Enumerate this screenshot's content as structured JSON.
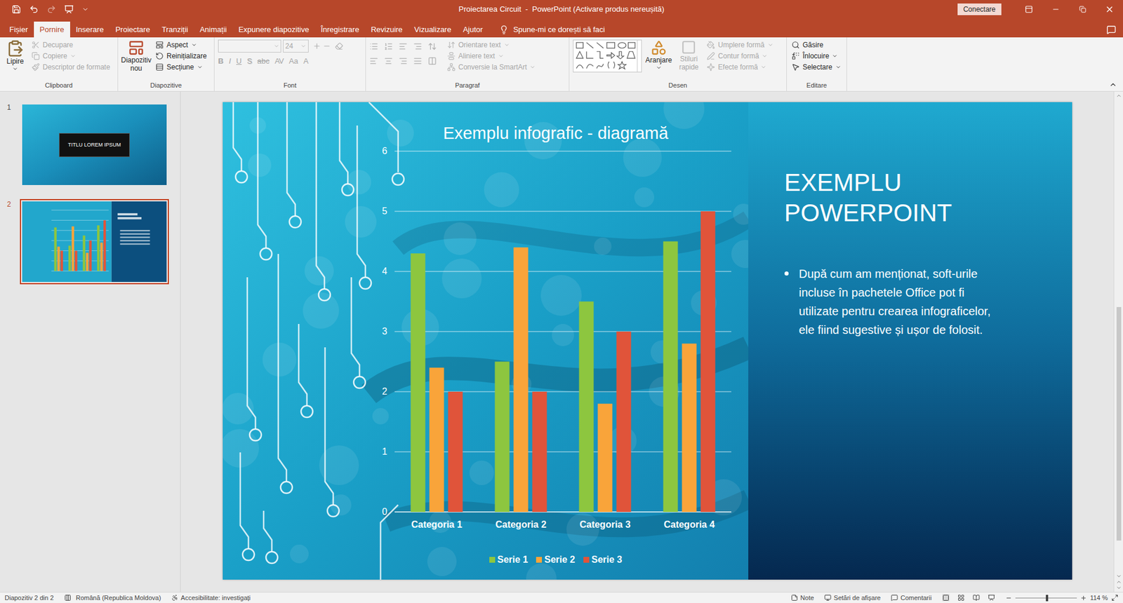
{
  "window": {
    "title": "Proiectarea Circuit  -  PowerPoint (Activare produs nereușită)",
    "sign_in": "Conectare"
  },
  "tabs": [
    {
      "label": "Fișier",
      "selected": false
    },
    {
      "label": "Pornire",
      "selected": true
    },
    {
      "label": "Inserare",
      "selected": false
    },
    {
      "label": "Proiectare",
      "selected": false
    },
    {
      "label": "Tranziții",
      "selected": false
    },
    {
      "label": "Animații",
      "selected": false
    },
    {
      "label": "Expunere diapozitive",
      "selected": false
    },
    {
      "label": "Înregistrare",
      "selected": false
    },
    {
      "label": "Revizuire",
      "selected": false
    },
    {
      "label": "Vizualizare",
      "selected": false
    },
    {
      "label": "Ajutor",
      "selected": false
    }
  ],
  "tell_me": "Spune-mi ce dorești să faci",
  "ribbon": {
    "clipboard": {
      "label": "Clipboard",
      "paste": "Lipire",
      "items": [
        {
          "label": "Decupare",
          "disabled": true
        },
        {
          "label": "Copiere",
          "disabled": true
        },
        {
          "label": "Descriptor de formate",
          "disabled": true
        }
      ]
    },
    "slides": {
      "label": "Diapozitive",
      "new_slide": "Diapozitiv nou",
      "items": [
        {
          "label": "Aspect",
          "disabled": false
        },
        {
          "label": "Reinițializare",
          "disabled": false
        },
        {
          "label": "Secțiune",
          "disabled": false
        }
      ]
    },
    "font": {
      "label": "Font",
      "font_size": "24",
      "disabled": true,
      "buttons": [
        "B",
        "I",
        "U",
        "S",
        "abc",
        "AV",
        "Aa",
        "A"
      ]
    },
    "paragraph": {
      "label": "Paragraf",
      "items": [
        {
          "label": "Orientare text",
          "disabled": true
        },
        {
          "label": "Aliniere text",
          "disabled": true
        },
        {
          "label": "Conversie la SmartArt",
          "disabled": true
        }
      ]
    },
    "drawing": {
      "label": "Desen",
      "arrange": "Aranjare",
      "quick_styles": "Stiluri rapide",
      "quick_styles_disabled": true,
      "items": [
        {
          "label": "Umplere formă",
          "disabled": true
        },
        {
          "label": "Contur formă",
          "disabled": true
        },
        {
          "label": "Efecte formă",
          "disabled": true
        }
      ]
    },
    "editing": {
      "label": "Editare",
      "items": [
        {
          "label": "Găsire",
          "disabled": false
        },
        {
          "label": "Înlocuire",
          "disabled": false
        },
        {
          "label": "Selectare",
          "disabled": false
        }
      ]
    }
  },
  "thumbnails": [
    {
      "number": "1",
      "selected": false,
      "title": "TITLU LOREM IPSUM"
    },
    {
      "number": "2",
      "selected": true
    }
  ],
  "slide": {
    "chart": {
      "title": "Exemplu infografic - diagramă",
      "y_ticks": [
        "0",
        "1",
        "2",
        "3",
        "4",
        "5",
        "6"
      ],
      "categories": [
        "Categoria 1",
        "Categoria 2",
        "Categoria 3",
        "Categoria 4"
      ],
      "series": [
        {
          "name": "Serie 1",
          "color": "#8dc63f",
          "values": [
            4.3,
            2.5,
            3.5,
            4.5
          ]
        },
        {
          "name": "Serie 2",
          "color": "#f9a43a",
          "values": [
            2.4,
            4.4,
            1.8,
            2.8
          ]
        },
        {
          "name": "Serie 3",
          "color": "#e0543a",
          "values": [
            2,
            2,
            3,
            5
          ]
        }
      ]
    },
    "heading": "EXEMPLU POWERPOINT",
    "bullets": [
      "După cum am menționat, soft-urile incluse în pachetele Office pot fi utilizate pentru crearea infograficelor, ele fiind sugestive și ușor de folosit."
    ]
  },
  "status_bar": {
    "slide_position": "Diapozitiv 2 din 2",
    "language": "Română (Republica Moldova)",
    "accessibility": "Accesibilitate: investigați",
    "notes": "Note",
    "display_settings": "Setări de afișare",
    "comments": "Comentarii",
    "zoom": "114 %",
    "zoom_level": 0.5
  }
}
